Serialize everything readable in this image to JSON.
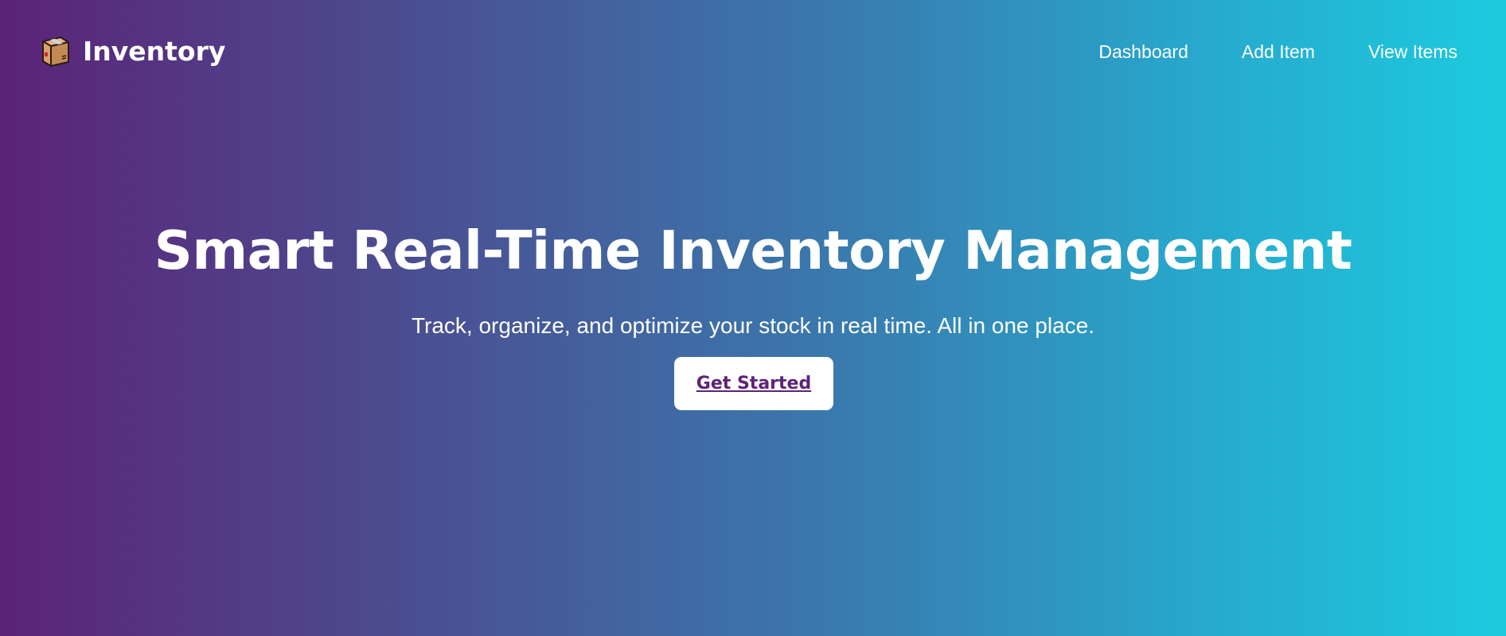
{
  "navbar": {
    "brand": {
      "icon": "package-box-icon",
      "name": "Inventory"
    },
    "links": [
      {
        "label": "Dashboard"
      },
      {
        "label": "Add Item"
      },
      {
        "label": "View Items"
      }
    ]
  },
  "hero": {
    "title": "Smart Real-Time Inventory Management",
    "subtitle": "Track, organize, and optimize your stock in real time. All in one place.",
    "cta_label": "Get Started"
  },
  "colors": {
    "gradient_start": "#5c2378",
    "gradient_end": "#1dcbdf",
    "cta_text": "#5c2378",
    "cta_background": "#ffffff",
    "text": "#ffffff"
  }
}
